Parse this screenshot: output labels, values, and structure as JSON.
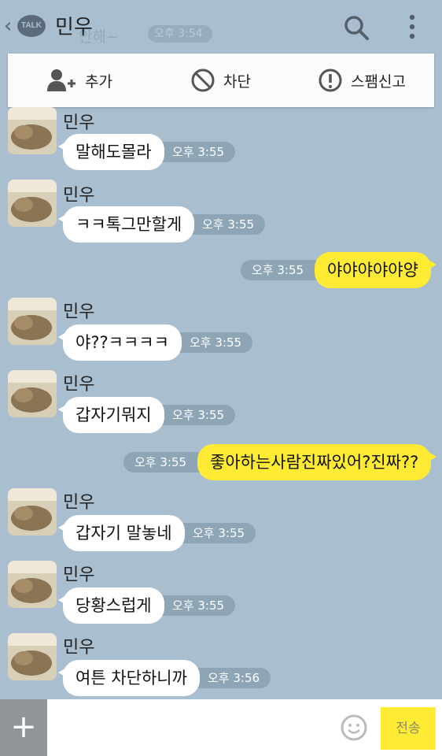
{
  "header": {
    "talk_badge": "TALK",
    "title": "민우",
    "ghost_preview": "안해~",
    "ghost_time": "오후 3:54"
  },
  "action_bar": {
    "add_label": "추가",
    "block_label": "차단",
    "spam_label": "스팸신고"
  },
  "messages": [
    {
      "side": "in",
      "sender": "민우",
      "text": "말해도몰라",
      "time": "오후 3:55"
    },
    {
      "side": "in",
      "sender": "민우",
      "text": "ㅋㅋ톡그만할게",
      "time": "오후 3:55"
    },
    {
      "side": "out",
      "text": "야야야야야양",
      "time": "오후 3:55"
    },
    {
      "side": "in",
      "sender": "민우",
      "text": "야??ㅋㅋㅋㅋ",
      "time": "오후 3:55"
    },
    {
      "side": "in",
      "sender": "민우",
      "text": "갑자기뭐지",
      "time": "오후 3:55"
    },
    {
      "side": "out",
      "text": "좋아하는사람진짜있어?진짜??",
      "time": "오후 3:55"
    },
    {
      "side": "in",
      "sender": "민우",
      "text": "갑자기 말놓네",
      "time": "오후 3:55"
    },
    {
      "side": "in",
      "sender": "민우",
      "text": "당황스럽게",
      "time": "오후 3:55"
    },
    {
      "side": "in",
      "sender": "민우",
      "text": "여튼 차단하니까",
      "time": "오후 3:56"
    }
  ],
  "input": {
    "plus_label": "+",
    "send_label": "전송",
    "placeholder": ""
  },
  "icons": {
    "back": "chevron-left-icon",
    "logo": "kakaotalk-logo",
    "search": "search-icon",
    "more": "more-vertical-icon",
    "add_friend": "add-friend-icon",
    "block": "block-icon",
    "spam": "warning-icon",
    "emoticon": "emoticon-icon"
  },
  "colors": {
    "background": "#a9bfd0",
    "outgoing_bubble": "#ffeb33",
    "incoming_bubble": "#ffffff",
    "timestamp_pill": "#8ea5b6"
  }
}
